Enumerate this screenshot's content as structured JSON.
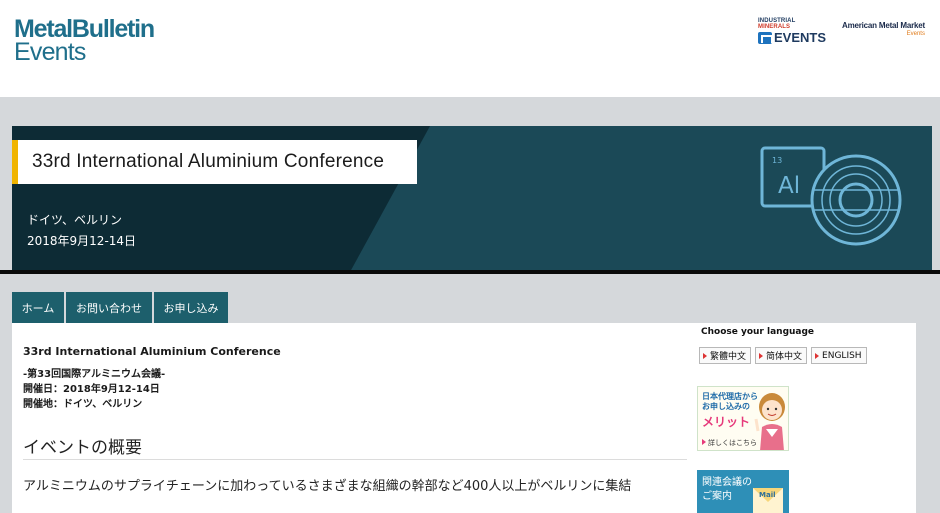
{
  "header": {
    "logo_line1": "MetalBulletin",
    "logo_line2": "Events",
    "im_logo_top_a": "INDUSTRIAL",
    "im_logo_top_b": "MINERALS",
    "im_logo_bottom": "EVENTS",
    "amm_logo_line1": "American Metal Market",
    "amm_logo_line2": "Events"
  },
  "hero": {
    "title": "33rd International Aluminium Conference",
    "location": "ドイツ、ベルリン",
    "dates": "2018年9月12-14日",
    "element_number": "13",
    "element_symbol": "Al"
  },
  "nav": {
    "tabs": [
      {
        "label": "ホーム"
      },
      {
        "label": "お問い合わせ"
      },
      {
        "label": "お申し込み"
      }
    ]
  },
  "content": {
    "title": "33rd International Aluminium Conference",
    "subtitle": "-第33回国際アルミニウム会議-",
    "date_line": "開催日：2018年9月12-14日",
    "venue_line": "開催地：ドイツ、ベルリン",
    "heading": "イベントの概要",
    "lead": "アルミニウムのサプライチェーンに加わっているさまざまな組織の幹部など400人以上がベルリンに集結"
  },
  "sidebar": {
    "language_label": "Choose your language",
    "languages": [
      {
        "label": "繁體中文"
      },
      {
        "label": "简体中文"
      },
      {
        "label": "ENGLISH"
      }
    ],
    "promo1": {
      "line1": "日本代理店から",
      "line2": "お申し込みの",
      "highlight": "メリット",
      "link": "詳しくはこちら"
    },
    "promo2": {
      "line1": "関連会議の",
      "line2": "ご案内",
      "mail_label": "Mail"
    }
  },
  "colors": {
    "brand_teal": "#1f6f8b",
    "hero_bg": "#0d2b35",
    "hero_stripe": "#1b4957",
    "accent_yellow": "#f0b400",
    "nav_tab": "#1d5f6c",
    "page_band": "#d5d8db"
  }
}
